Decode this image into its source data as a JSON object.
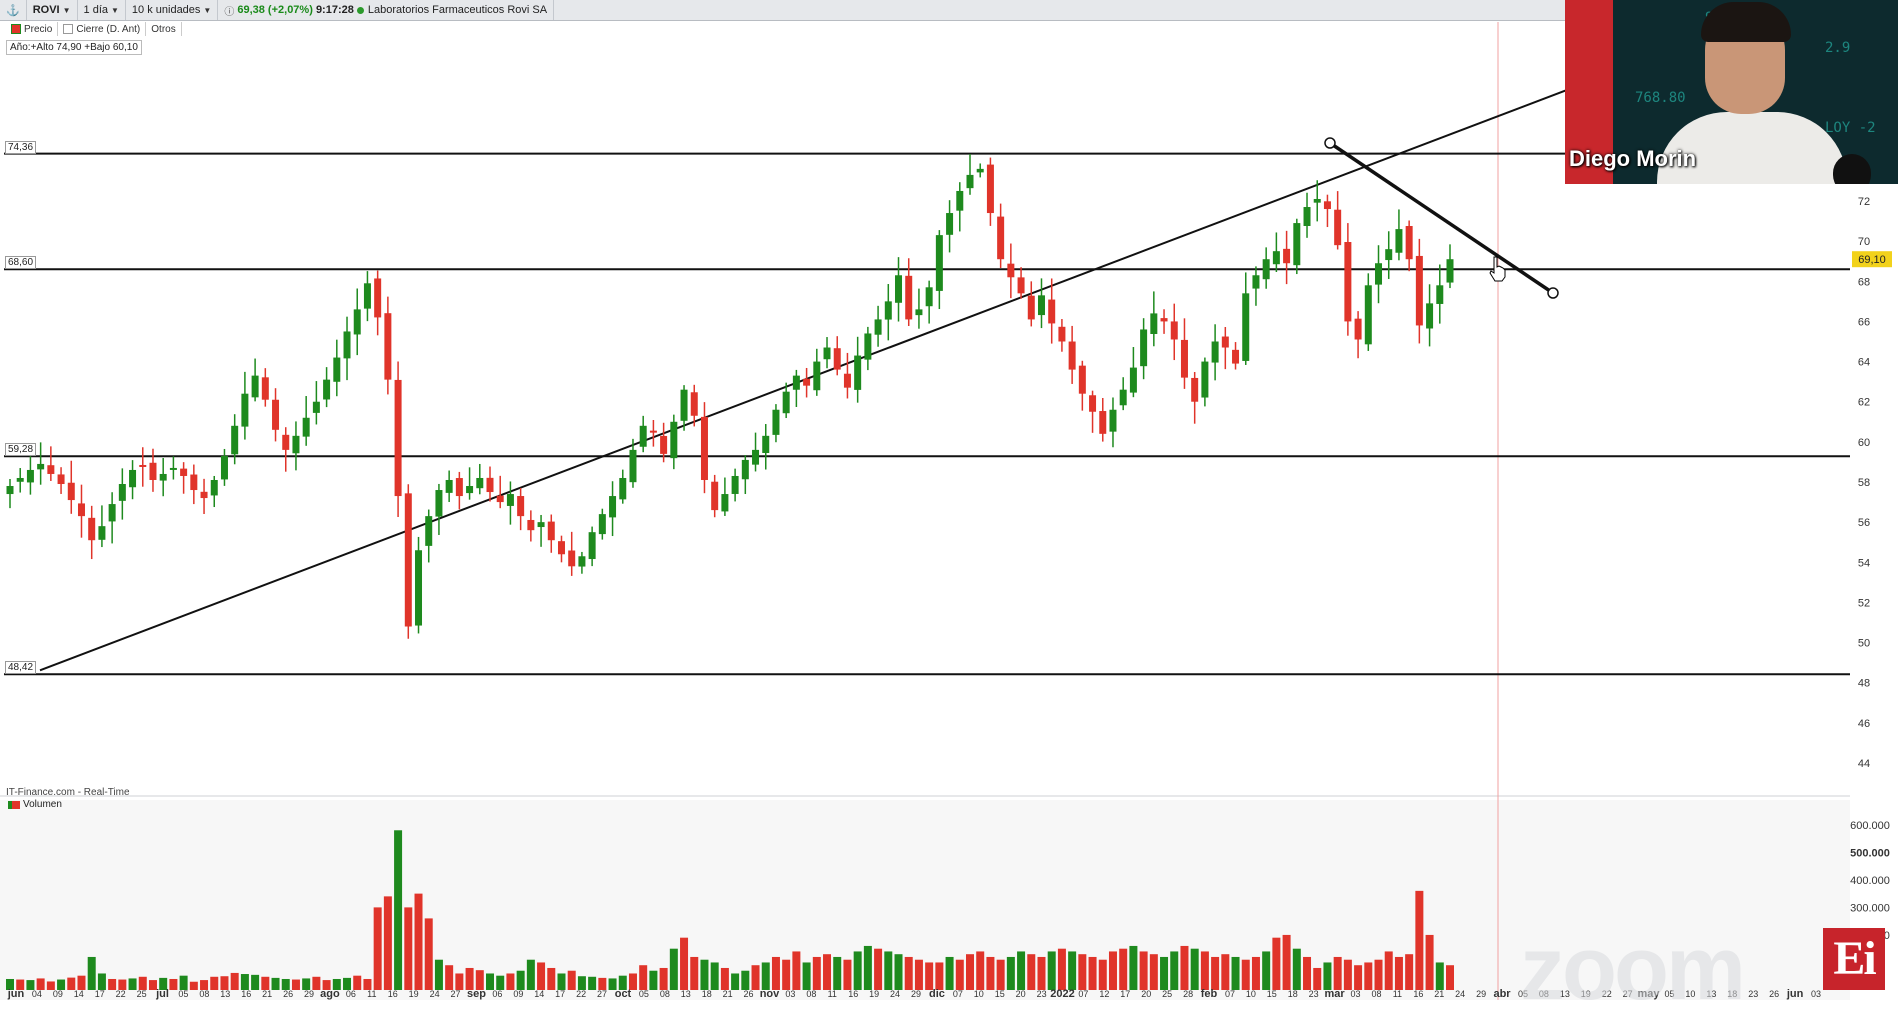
{
  "toolbar": {
    "ticker": "ROVI",
    "interval": "1 día",
    "units": "10 k unidades",
    "price": "69,38 (+2,07%)",
    "time": "9:17:28",
    "company": "Laboratorios Farmaceuticos Rovi SA"
  },
  "legend": {
    "price": "Precio",
    "close": "Cierre (D. Ant)",
    "others": "Otros"
  },
  "year_range": "Año:+Alto 74,90 +Bajo 60,10",
  "levels": [
    {
      "label": "74,36",
      "value": 74.36
    },
    {
      "label": "68,60",
      "value": 68.6
    },
    {
      "label": "59,28",
      "value": 59.28
    },
    {
      "label": "48,42",
      "value": 48.42
    }
  ],
  "current_price_tag": "69,10",
  "source_label": "IT-Finance.com - Real-Time",
  "volume_legend": "Volumen",
  "webcam": {
    "name": "Diego Morin"
  },
  "logo": "Ei",
  "watermark": "zoom",
  "colors": {
    "up": "#1e8a1e",
    "down": "#e0342a",
    "line": "#111111"
  },
  "chart_data": {
    "type": "bar",
    "price_axis": {
      "ticks": [
        "72",
        "70",
        "68",
        "66",
        "64",
        "62",
        "60",
        "58",
        "56",
        "54",
        "52",
        "50",
        "48",
        "46",
        "44"
      ],
      "range": [
        43,
        76
      ]
    },
    "volume_axis": {
      "ticks": [
        "600.000",
        "500.000",
        "400.000",
        "300.000",
        "200.000"
      ],
      "range": [
        0,
        650000
      ]
    },
    "x_labels": [
      "jun",
      "04",
      "09",
      "14",
      "17",
      "22",
      "25",
      "jul",
      "05",
      "08",
      "13",
      "16",
      "21",
      "26",
      "29",
      "ago",
      "06",
      "11",
      "16",
      "19",
      "24",
      "27",
      "sep",
      "06",
      "09",
      "14",
      "17",
      "22",
      "27",
      "oct",
      "05",
      "08",
      "13",
      "18",
      "21",
      "26",
      "nov",
      "03",
      "08",
      "11",
      "16",
      "19",
      "24",
      "29",
      "dic",
      "07",
      "10",
      "15",
      "20",
      "23",
      "2022",
      "07",
      "12",
      "17",
      "20",
      "25",
      "28",
      "feb",
      "07",
      "10",
      "15",
      "18",
      "23",
      "mar",
      "03",
      "08",
      "11",
      "16",
      "21",
      "24",
      "29",
      "abr",
      "05",
      "08",
      "13",
      "19",
      "22",
      "27",
      "may",
      "05",
      "10",
      "13",
      "18",
      "23",
      "26",
      "jun",
      "03"
    ],
    "closes": [
      57.8,
      58.2,
      58.6,
      58.9,
      58.4,
      57.9,
      57.1,
      56.3,
      55.1,
      55.8,
      56.9,
      57.9,
      58.6,
      58.8,
      58.1,
      58.4,
      58.7,
      58.3,
      57.6,
      57.2,
      58.1,
      59.3,
      60.8,
      62.4,
      63.3,
      62.1,
      60.6,
      59.6,
      60.3,
      61.2,
      62.0,
      63.1,
      64.2,
      65.5,
      66.6,
      67.9,
      66.2,
      63.1,
      57.3,
      50.8,
      54.6,
      56.3,
      57.6,
      58.1,
      57.3,
      57.8,
      58.2,
      57.5,
      57.0,
      57.4,
      56.3,
      55.6,
      56.0,
      55.1,
      54.4,
      53.8,
      54.3,
      55.5,
      56.4,
      57.3,
      58.2,
      59.6,
      60.8,
      60.5,
      59.4,
      61.0,
      62.6,
      61.3,
      58.1,
      56.6,
      57.4,
      58.3,
      59.1,
      59.6,
      60.3,
      61.6,
      62.5,
      63.3,
      62.8,
      64.0,
      64.7,
      63.6,
      62.7,
      64.3,
      65.4,
      66.1,
      67.0,
      68.3,
      66.1,
      66.6,
      67.7,
      70.3,
      71.4,
      72.5,
      73.3,
      73.6,
      71.4,
      69.1,
      68.2,
      67.4,
      66.1,
      67.3,
      65.9,
      65.0,
      63.6,
      62.4,
      61.5,
      60.4,
      61.6,
      62.6,
      63.7,
      65.6,
      66.4,
      66.0,
      65.1,
      63.2,
      62.0,
      64.0,
      65.0,
      64.7,
      63.9,
      67.4,
      68.3,
      69.1,
      69.5,
      68.9,
      70.9,
      71.7,
      72.1,
      71.6,
      69.8,
      66.0,
      65.1,
      67.8,
      68.9,
      69.6,
      70.6,
      69.1,
      65.8,
      66.9,
      67.8,
      69.1
    ],
    "volumes": [
      40000,
      38000,
      36000,
      42000,
      31000,
      38000,
      45000,
      52000,
      120000,
      60000,
      40000,
      38000,
      42000,
      48000,
      36000,
      44000,
      40000,
      52000,
      30000,
      36000,
      48000,
      50000,
      62000,
      58000,
      55000,
      48000,
      44000,
      40000,
      38000,
      42000,
      48000,
      36000,
      40000,
      44000,
      52000,
      40000,
      300000,
      340000,
      580000,
      300000,
      350000,
      260000,
      110000,
      90000,
      60000,
      80000,
      72000,
      60000,
      52000,
      60000,
      70000,
      110000,
      100000,
      80000,
      60000,
      70000,
      50000,
      48000,
      44000,
      42000,
      52000,
      60000,
      90000,
      70000,
      80000,
      150000,
      190000,
      120000,
      110000,
      100000,
      80000,
      60000,
      70000,
      90000,
      100000,
      120000,
      110000,
      140000,
      100000,
      120000,
      130000,
      120000,
      110000,
      140000,
      160000,
      150000,
      140000,
      130000,
      120000,
      110000,
      100000,
      100000,
      120000,
      110000,
      130000,
      140000,
      120000,
      110000,
      120000,
      140000,
      130000,
      120000,
      140000,
      150000,
      140000,
      130000,
      120000,
      110000,
      140000,
      150000,
      160000,
      140000,
      130000,
      120000,
      140000,
      160000,
      150000,
      140000,
      120000,
      130000,
      120000,
      110000,
      120000,
      140000,
      190000,
      200000,
      150000,
      120000,
      80000,
      100000,
      120000,
      110000,
      90000,
      100000,
      110000,
      140000,
      120000,
      130000,
      360000,
      200000,
      100000,
      90000
    ]
  }
}
